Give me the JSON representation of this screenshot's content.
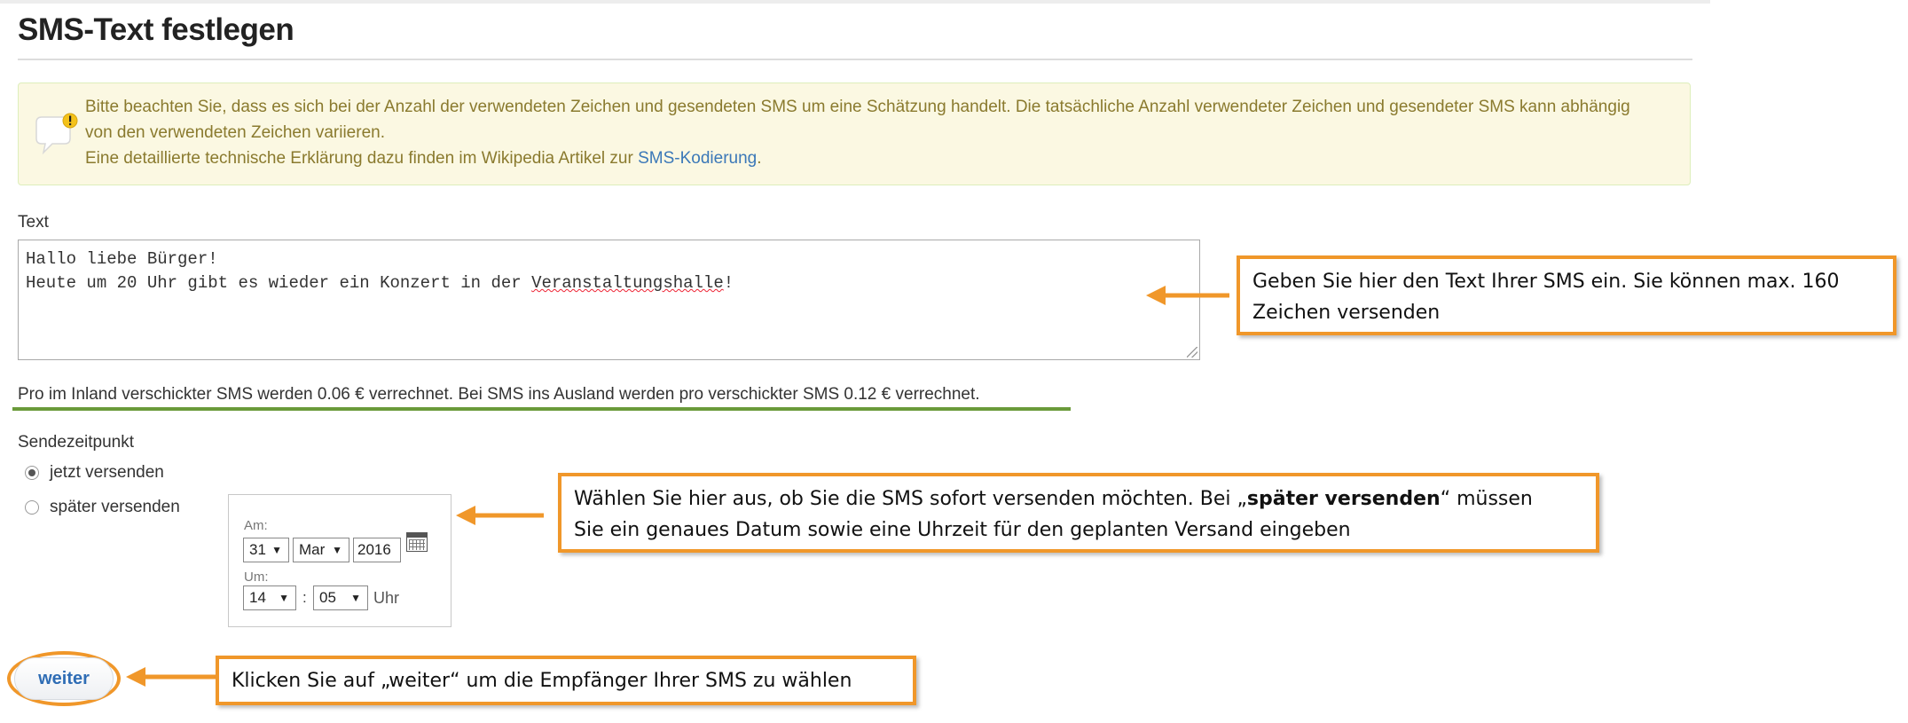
{
  "page": {
    "title": "SMS-Text festlegen"
  },
  "notice": {
    "icon": "speech-bubble-warning-icon",
    "line1": "Bitte beachten Sie, dass es sich bei der Anzahl der verwendeten Zeichen und gesendeten SMS um eine Schätzung handelt. Die tatsächliche Anzahl verwendeter Zeichen und gesendeter SMS kann abhängig",
    "line2": "von den verwendeten Zeichen variieren.",
    "line3_prefix": "Eine detaillierte technische Erklärung dazu finden im Wikipedia Artikel zur ",
    "link_text": "SMS-Kodierung",
    "line3_suffix": "."
  },
  "text_field": {
    "label": "Text",
    "line1": "Hallo liebe Bürger!",
    "line2_prefix": "Heute um 20 Uhr gibt es wieder ein Konzert in der ",
    "line2_misspelled": "Veranstaltungshalle",
    "line2_suffix": "!"
  },
  "price_note": "Pro im Inland verschickter SMS werden 0.06 € verrechnet. Bei SMS ins Ausland werden pro verschickter SMS 0.12 € verrechnet.",
  "send_time": {
    "label": "Sendezeitpunkt",
    "options": [
      {
        "label": "jetzt versenden",
        "selected": true
      },
      {
        "label": "später versenden",
        "selected": false
      }
    ],
    "date_label": "Am:",
    "day": "31",
    "month": "Mar",
    "year": "2016",
    "time_label": "Um:",
    "hour": "14",
    "separator": ":",
    "minute": "05",
    "unit": "Uhr",
    "dropdown_arrow": "▼",
    "calendar_icon": "calendar-icon"
  },
  "buttons": {
    "next_label": "weiter"
  },
  "callouts": {
    "text_hint": {
      "line1": "Geben Sie hier den Text Ihrer SMS ein. Sie können max. 160",
      "line2": "Zeichen versenden"
    },
    "time_hint": {
      "line1_prefix": "Wählen Sie hier aus, ob Sie die SMS sofort versenden möchten. Bei „",
      "line1_bold": "später versenden",
      "line1_suffix": "“ müssen",
      "line2": "Sie ein genaues Datum sowie eine Uhrzeit für den geplanten Versand eingeben"
    },
    "next_hint": "Klicken Sie auf „weiter“ um die Empfänger Ihrer SMS zu wählen"
  },
  "colors": {
    "annotation_orange": "#f0972a",
    "notice_background": "#fbf8e2",
    "notice_text": "#8a7a2e",
    "link": "#3b78b8",
    "price_underline": "#6a9a3a",
    "button_text": "#2f6db5"
  }
}
